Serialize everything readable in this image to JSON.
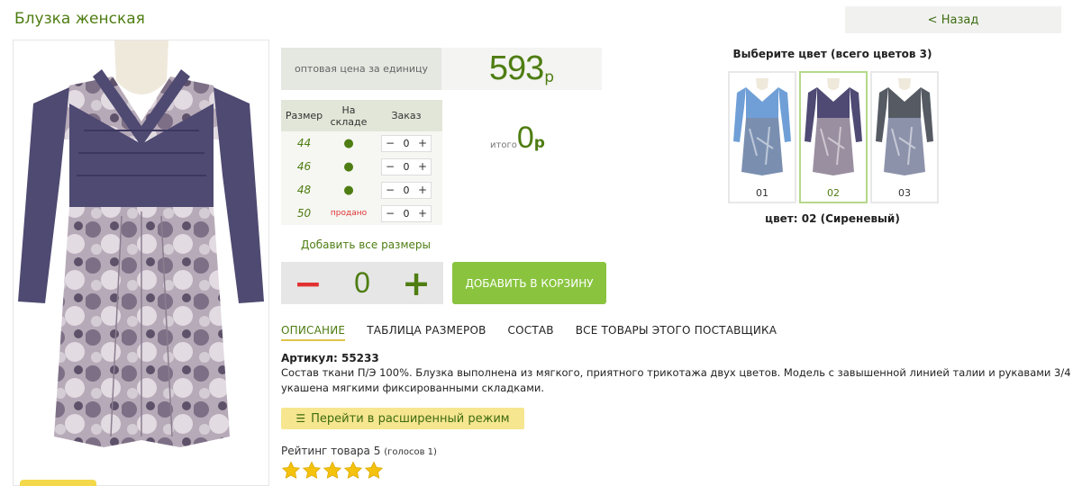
{
  "product": {
    "title": "Блузка женская",
    "back_label": "< Назад",
    "price_label": "оптовая цена за единицу",
    "price_value": "593",
    "currency": "р"
  },
  "sizes": {
    "headers": [
      "Размер",
      "На складе",
      "Заказ"
    ],
    "rows": [
      {
        "size": "44",
        "stock": "●",
        "qty": "0"
      },
      {
        "size": "46",
        "stock": "●",
        "qty": "0"
      },
      {
        "size": "48",
        "stock": "●",
        "qty": "0"
      },
      {
        "size": "50",
        "stock": "продано",
        "qty": "0"
      }
    ],
    "minus": "−",
    "plus": "+"
  },
  "total": {
    "label": "итого",
    "value": "0",
    "currency": "р"
  },
  "add_all_label": "Добавить все размеры",
  "order": {
    "qty": "0",
    "minus": "−",
    "plus": "+",
    "cart_label": "ДОБАВИТЬ В КОРЗИНУ"
  },
  "tabs": [
    "ОПИСАНИЕ",
    "ТАБЛИЦА РАЗМЕРОВ",
    "СОСТАВ",
    "ВСЕ ТОВАРЫ ЭТОГО ПОСТАВЩИКА"
  ],
  "description": {
    "article": "Артикул: 55233",
    "text": "Состав ткани П/Э 100%. Блузка выполнена из мягкого, приятного трикотажа двух цветов. Модель с завышенной линией талии и рукавами 3/4 укашена мягкими фиксированными складками."
  },
  "extended_mode_label": "Перейти в расширенный режим",
  "rating": {
    "label": "Рейтинг товара 5",
    "votes": "(голосов 1)",
    "stars": 5
  },
  "colors": {
    "title": "Выберите цвет (всего цветов 3)",
    "items": [
      {
        "num": "01",
        "top": "#6f9fd6",
        "print": "#7a8fb0"
      },
      {
        "num": "02",
        "top": "#4e4a74",
        "print": "#9a8fa0"
      },
      {
        "num": "03",
        "top": "#555a63",
        "print": "#8c92aa"
      }
    ],
    "selected_label": "цвет: 02 (Сиреневый)"
  },
  "accent": "#4e7d12"
}
